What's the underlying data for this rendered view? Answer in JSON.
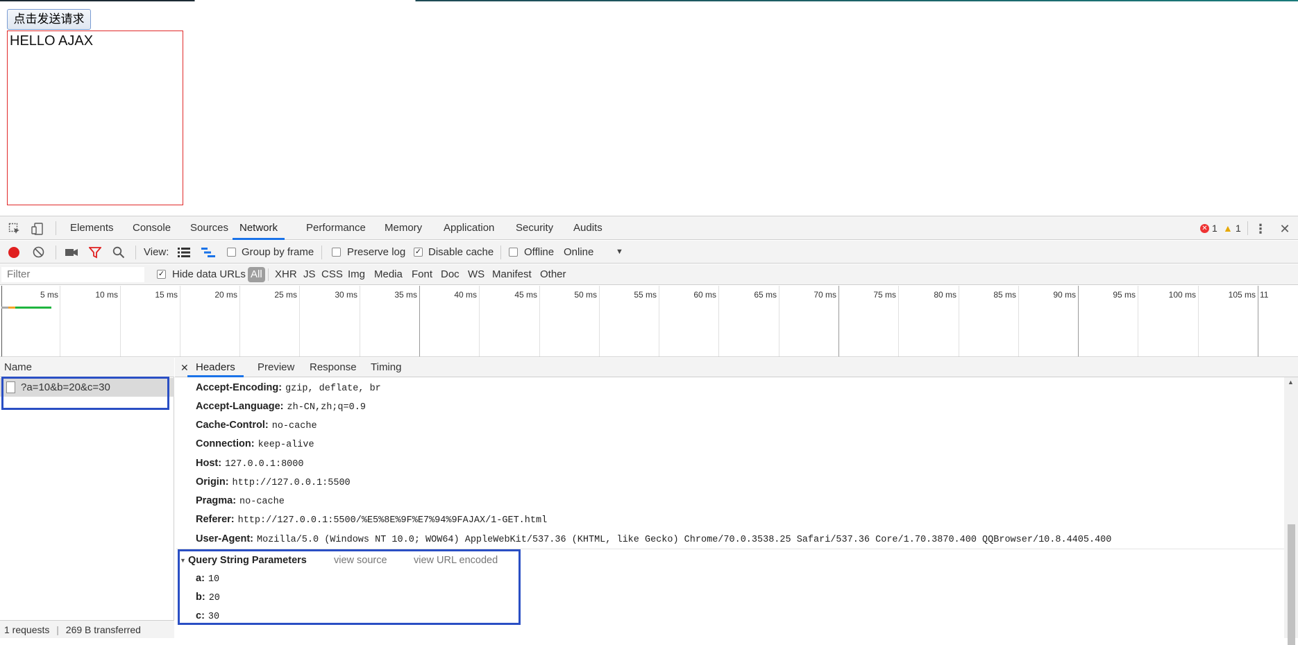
{
  "page": {
    "send_button": "点击发送请求",
    "result_text": "HELLO AJAX"
  },
  "devtools": {
    "tabs": [
      "Elements",
      "Console",
      "Sources",
      "Network",
      "Performance",
      "Memory",
      "Application",
      "Security",
      "Audits"
    ],
    "active_tab": "Network",
    "error_count": "1",
    "warning_count": "1",
    "toolbar": {
      "view_label": "View:",
      "group_by_frame": "Group by frame",
      "preserve_log": "Preserve log",
      "disable_cache": "Disable cache",
      "offline": "Offline",
      "throttle": "Online"
    },
    "filter": {
      "placeholder": "Filter",
      "hide_data_urls": "Hide data URLs",
      "types": [
        "All",
        "XHR",
        "JS",
        "CSS",
        "Img",
        "Media",
        "Font",
        "Doc",
        "WS",
        "Manifest",
        "Other"
      ]
    },
    "timeline_ticks": [
      "5 ms",
      "10 ms",
      "15 ms",
      "20 ms",
      "25 ms",
      "30 ms",
      "35 ms",
      "40 ms",
      "45 ms",
      "50 ms",
      "55 ms",
      "60 ms",
      "65 ms",
      "70 ms",
      "75 ms",
      "80 ms",
      "85 ms",
      "90 ms",
      "95 ms",
      "100 ms",
      "105 ms",
      "11"
    ],
    "request_list": {
      "header": "Name",
      "rows": [
        "?a=10&b=20&c=30"
      ],
      "status_requests": "1 requests",
      "status_transferred": "269 B transferred"
    },
    "detail": {
      "tabs": [
        "Headers",
        "Preview",
        "Response",
        "Timing"
      ],
      "active_tab": "Headers",
      "headers": [
        {
          "key": "Accept-Encoding:",
          "value": "gzip, deflate, br"
        },
        {
          "key": "Accept-Language:",
          "value": "zh-CN,zh;q=0.9"
        },
        {
          "key": "Cache-Control:",
          "value": "no-cache"
        },
        {
          "key": "Connection:",
          "value": "keep-alive"
        },
        {
          "key": "Host:",
          "value": "127.0.0.1:8000"
        },
        {
          "key": "Origin:",
          "value": "http://127.0.0.1:5500"
        },
        {
          "key": "Pragma:",
          "value": "no-cache"
        },
        {
          "key": "Referer:",
          "value": "http://127.0.0.1:5500/%E5%8E%9F%E7%94%9FAJAX/1-GET.html"
        },
        {
          "key": "User-Agent:",
          "value": "Mozilla/5.0 (Windows NT 10.0; WOW64) AppleWebKit/537.36 (KHTML, like Gecko) Chrome/70.0.3538.25 Safari/537.36 Core/1.70.3870.400 QQBrowser/10.8.4405.400"
        }
      ],
      "query_section": {
        "title": "Query String Parameters",
        "view_source": "view source",
        "view_url_encoded": "view URL encoded",
        "params": [
          {
            "key": "a:",
            "value": "10"
          },
          {
            "key": "b:",
            "value": "20"
          },
          {
            "key": "c:",
            "value": "30"
          }
        ]
      }
    }
  }
}
